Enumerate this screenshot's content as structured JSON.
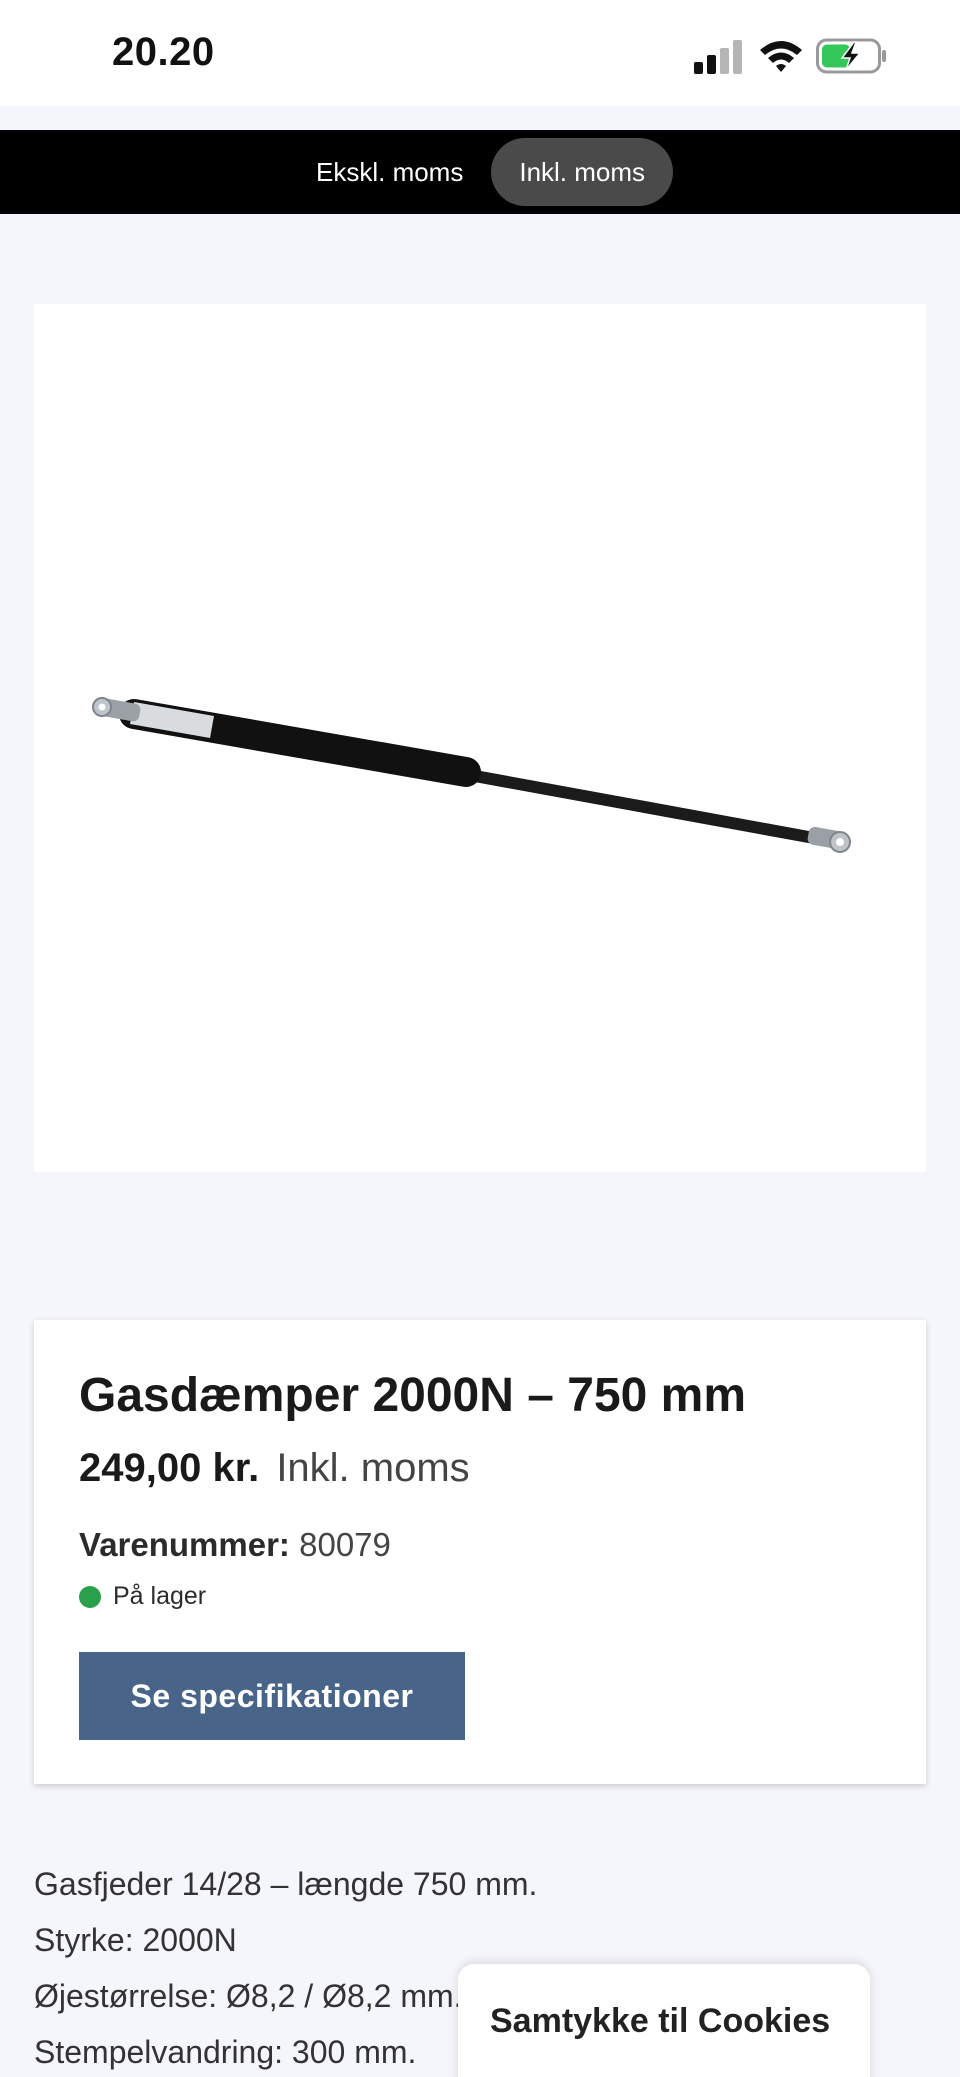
{
  "status_bar": {
    "time": "20.20",
    "icons": [
      "signal-icon",
      "wifi-icon",
      "battery-charging-icon"
    ]
  },
  "tax_toggle": {
    "options": [
      {
        "label": "Ekskl. moms",
        "active": false
      },
      {
        "label": "Inkl. moms",
        "active": true
      }
    ]
  },
  "product": {
    "image": "gas-spring-image",
    "title": "Gasdæmper 2000N – 750 mm",
    "price": "249,00 kr.",
    "price_suffix": "Inkl. moms",
    "sku_label": "Varenummer:",
    "sku_value": "80079",
    "stock_status": "På lager",
    "spec_button_label": "Se specifikationer"
  },
  "description": {
    "lines": [
      "Gasfjeder 14/28 – længde 750 mm.",
      "Styrke: 2000N",
      "Øjestørrelse: Ø8,2 / Ø8,2 mm.",
      "Stempelvandring: 300 mm."
    ]
  },
  "cookie_banner": {
    "title": "Samtykke til Cookies"
  },
  "colors": {
    "accent_button": "#486489",
    "stock_green": "#2aa04a",
    "tax_bar": "#000000",
    "page_background": "#f5f6fb"
  }
}
